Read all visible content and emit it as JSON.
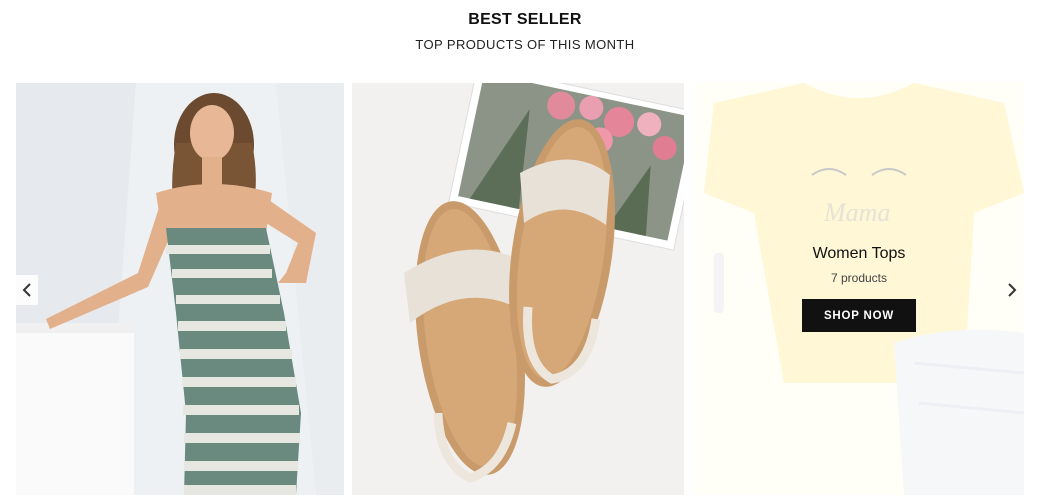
{
  "section": {
    "title": "BEST SELLER",
    "subtitle": "TOP PRODUCTS OF THIS MONTH"
  },
  "carousel": {
    "prev_icon": "chevron-left-icon",
    "next_icon": "chevron-right-icon",
    "prev_glyph": "‹",
    "next_glyph": "›",
    "items": [
      {
        "image": "striped-dress-model"
      },
      {
        "image": "beige-flat-sandals"
      },
      {
        "image": "mama-tshirt",
        "name": "Women Tops",
        "count": "7 products",
        "cta": "SHOP NOW"
      }
    ]
  },
  "colors": {
    "button_bg": "#111111",
    "button_text": "#ffffff"
  }
}
